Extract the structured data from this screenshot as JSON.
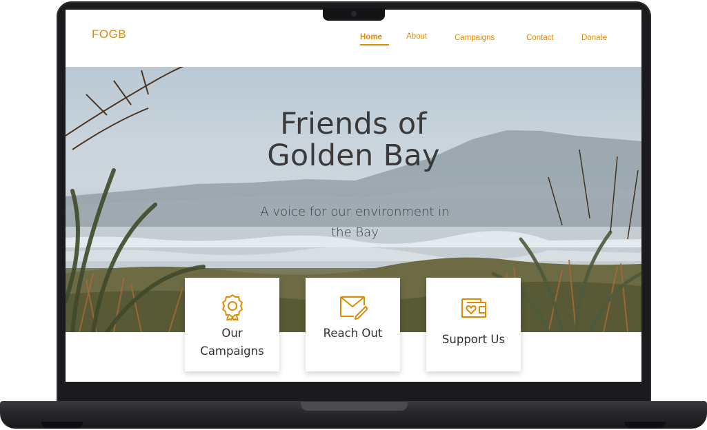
{
  "site": {
    "logo": "FOGB",
    "accent_color": "#e08a00",
    "nav": {
      "items": [
        {
          "label": "Home",
          "active": true
        },
        {
          "label": "About",
          "active": false
        },
        {
          "label": "Campaigns",
          "active": false
        },
        {
          "label": "Contact",
          "active": false
        },
        {
          "label": "Donate",
          "active": false
        }
      ]
    }
  },
  "hero": {
    "title_line1": "Friends of",
    "title_line2": "Golden Bay",
    "subtitle": "A voice for our environment in the Bay"
  },
  "cards": [
    {
      "label_line1": "Our",
      "label_line2": "Campaigns",
      "icon": "award-badge-icon"
    },
    {
      "label": "Reach Out",
      "icon": "envelope-pencil-icon"
    },
    {
      "label": "Support Us",
      "icon": "wallet-heart-icon"
    }
  ]
}
